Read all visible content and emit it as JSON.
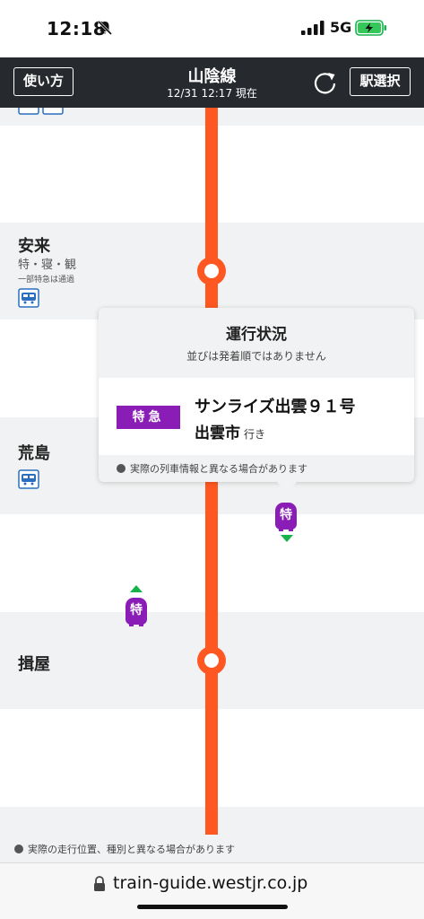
{
  "status_bar": {
    "time": "12:18",
    "network": "5G",
    "icons": [
      "bell-slash-icon",
      "signal-icon",
      "battery-charging-icon"
    ]
  },
  "header": {
    "left_button": "使い方",
    "title": "山陰線",
    "subtitle": "12/31 12:17 現在",
    "right_button": "駅選択",
    "reload_icon": "reload-icon"
  },
  "line_color": "#ff5722",
  "stations": [
    {
      "name": "安来",
      "types": "特・寝・観",
      "note": "一部特急は通過",
      "bus": true
    },
    {
      "name": "荒島",
      "types": "",
      "note": "",
      "bus": true
    },
    {
      "name": "揖屋",
      "types": "",
      "note": "",
      "bus": false
    }
  ],
  "trains": [
    {
      "label": "特",
      "type": "特急",
      "direction": "down",
      "color": "#8a1db5"
    },
    {
      "label": "特",
      "type": "特急",
      "direction": "up",
      "color": "#8a1db5"
    }
  ],
  "popup": {
    "title": "運行状況",
    "subtitle": "並びは発着順ではありません",
    "badge": "特急",
    "train_name": "サンライズ出雲９１号",
    "destination": "出雲市",
    "destination_suffix": "行き",
    "note": "実際の列車情報と異なる場合があります"
  },
  "footer_note": "実際の走行位置、種別と異なる場合があります",
  "url": "train-guide.westjr.co.jp"
}
